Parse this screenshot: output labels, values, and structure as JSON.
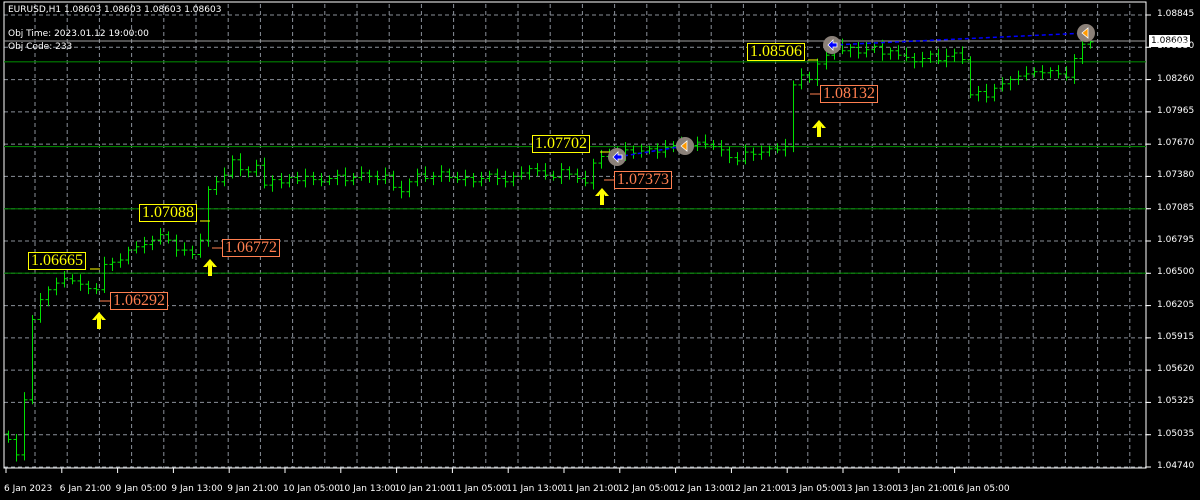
{
  "header": {
    "symbol_line": "EURUSD,H1  1.08603 1.08603 1.08603 1.08603",
    "obj_time": "Obj Time: 2023.01.12 19:00:00",
    "obj_code": "Obj Code: 233"
  },
  "current_price": "1.08603",
  "colors": {
    "background": "#000000",
    "bars": "#00e000",
    "grid": "#8a9099",
    "high_label": "#ffff00",
    "low_label": "#ff7f50",
    "level_line": "#008000",
    "trade_line": "#0000ff",
    "arrow": "#ffff00"
  },
  "chart_data": {
    "type": "ohlc",
    "symbol": "EURUSD",
    "timeframe": "H1",
    "ylim": [
      1.0474,
      1.08845
    ],
    "y_ticks": [
      "1.08845",
      "1.08550",
      "1.08260",
      "1.07965",
      "1.07670",
      "1.07380",
      "1.07085",
      "1.06795",
      "1.06500",
      "1.06205",
      "1.05915",
      "1.05620",
      "1.05325",
      "1.05035",
      "1.04740"
    ],
    "x_ticks": [
      "6 Jan 2023",
      "6 Jan 21:00",
      "9 Jan 05:00",
      "9 Jan 13:00",
      "9 Jan 21:00",
      "10 Jan 05:00",
      "10 Jan 13:00",
      "10 Jan 21:00",
      "11 Jan 05:00",
      "11 Jan 13:00",
      "11 Jan 21:00",
      "12 Jan 05:00",
      "12 Jan 13:00",
      "12 Jan 21:00",
      "13 Jan 05:00",
      "13 Jan 13:00",
      "13 Jan 21:00",
      "16 Jan 05:00"
    ],
    "grid": true,
    "closes": [
      1.0499,
      1.0485,
      1.0535,
      1.0608,
      1.0626,
      1.0635,
      1.0641,
      1.0645,
      1.0643,
      1.064,
      1.0636,
      1.0635,
      1.0658,
      1.066,
      1.0662,
      1.0671,
      1.0674,
      1.0676,
      1.068,
      1.0685,
      1.068,
      1.0671,
      1.0671,
      1.0667,
      1.068,
      1.0726,
      1.0733,
      1.0739,
      1.0753,
      1.0744,
      1.0742,
      1.0748,
      1.073,
      1.0735,
      1.0732,
      1.0737,
      1.0734,
      1.0738,
      1.0735,
      1.0733,
      1.0736,
      1.0739,
      1.0734,
      1.0737,
      1.0741,
      1.0738,
      1.0735,
      1.0739,
      1.0728,
      1.0724,
      1.0733,
      1.074,
      1.0736,
      1.0738,
      1.0742,
      1.0737,
      1.0735,
      1.0737,
      1.0733,
      1.0736,
      1.074,
      1.0736,
      1.0733,
      1.0738,
      1.0741,
      1.0745,
      1.0743,
      1.0739,
      1.0737,
      1.0744,
      1.074,
      1.0736,
      1.0732,
      1.075,
      1.0756,
      1.076,
      1.0758,
      1.0762,
      1.0759,
      1.0761,
      1.0763,
      1.076,
      1.0764,
      1.0766,
      1.0768,
      1.0766,
      1.0769,
      1.0767,
      1.0765,
      1.0762,
      1.0755,
      1.0752,
      1.076,
      1.0758,
      1.076,
      1.0763,
      1.0762,
      1.0765,
      1.0821,
      1.083,
      1.0826,
      1.084,
      1.0848,
      1.0857,
      1.0852,
      1.0855,
      1.085,
      1.0853,
      1.0856,
      1.0849,
      1.0852,
      1.0848,
      1.0846,
      1.0842,
      1.0845,
      1.0849,
      1.0843,
      1.0847,
      1.085,
      1.0844,
      1.0812,
      1.0815,
      1.081,
      1.0818,
      1.0822,
      1.0826,
      1.0829,
      1.0831,
      1.0833,
      1.0832,
      1.0834,
      1.0831,
      1.0828,
      1.0845,
      1.0858,
      1.086
    ],
    "level_lines": [
      1.0842,
      1.0765,
      1.07085,
      1.065
    ],
    "bid_line": 1.08603,
    "high_labels": [
      "1.06665",
      "1.07088",
      "1.07702",
      "1.08506"
    ],
    "low_labels": [
      "1.06292",
      "1.06772",
      "1.07373",
      "1.08132"
    ],
    "buy_arrows": 4,
    "trades": [
      {
        "open_bar": 76,
        "close_bar": 84,
        "open_price": 1.0756,
        "close_price": 1.0768
      },
      {
        "open_bar": 103,
        "close_bar": 135,
        "open_price": 1.0856,
        "close_price": 1.0869
      }
    ]
  }
}
